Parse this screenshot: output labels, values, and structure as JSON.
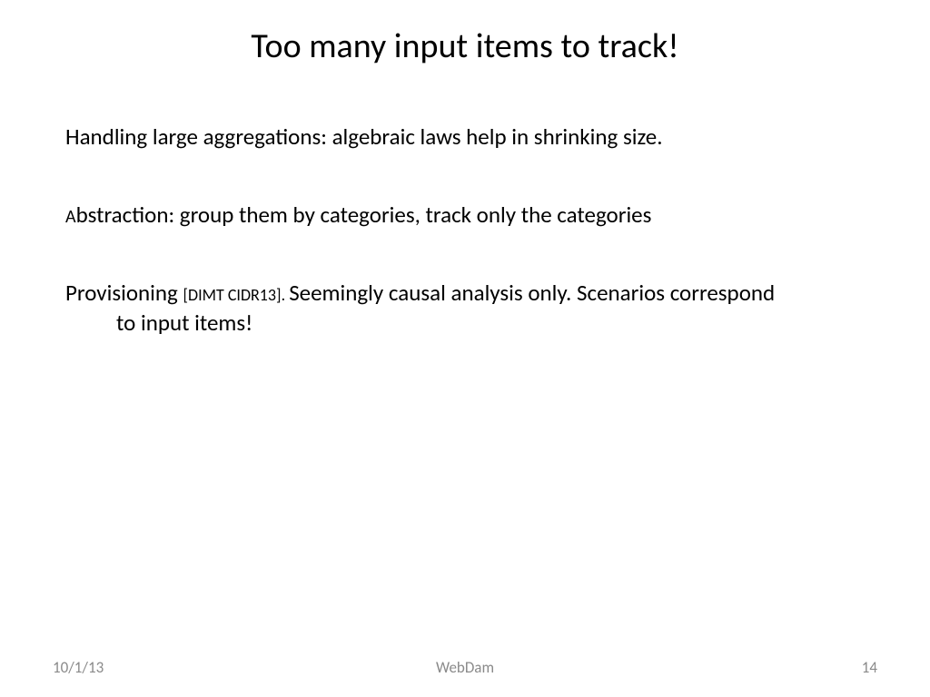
{
  "slide": {
    "title": "Too many input items to track!",
    "bullets": [
      {
        "text": "Handling large aggregations: algebraic laws help in shrinking size."
      },
      {
        "prefix": "A",
        "text": "bstraction: group them by categories, track only the categories"
      },
      {
        "prefix_main": "Provisioning ",
        "citation": "[DIMT CIDR13]. ",
        "text_main": "Seemingly causal analysis only. Scenarios correspond",
        "continuation": "to input items!"
      }
    ]
  },
  "footer": {
    "date": "10/1/13",
    "center": "WebDam",
    "page": "14"
  }
}
